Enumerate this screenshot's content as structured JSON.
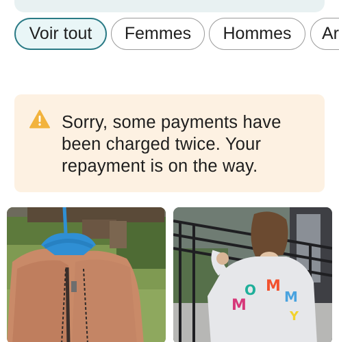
{
  "filters": {
    "chips": [
      {
        "label": "Voir tout",
        "active": true
      },
      {
        "label": "Femmes",
        "active": false
      },
      {
        "label": "Hommes",
        "active": false
      },
      {
        "label": "Ar",
        "active": false
      }
    ]
  },
  "alert": {
    "icon": "warning-icon",
    "icon_color": "#f2b33d",
    "message": "Sorry, some payments have been charged twice. Your repayment is on the way."
  },
  "products": [
    {
      "image": "brown-fleece-jacket-on-blue-hanger"
    },
    {
      "image": "child-wearing-grey-sweatshirt-with-colorful-letters"
    }
  ],
  "colors": {
    "accent": "#2a7a85",
    "alert_bg": "#fdf1e2",
    "chip_active_bg": "#e9f6f7"
  }
}
